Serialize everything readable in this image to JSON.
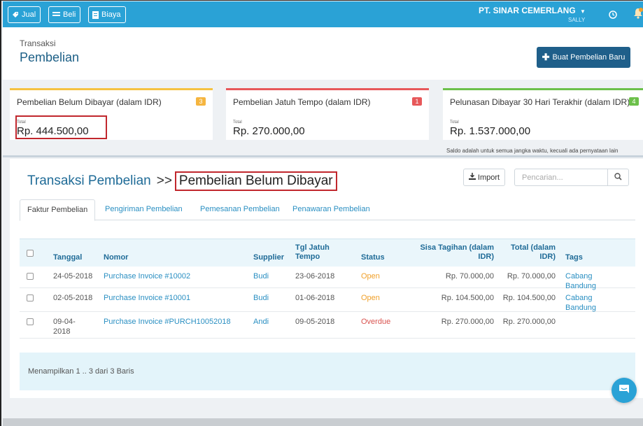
{
  "topbar": {
    "sell_label": "Jual",
    "buy_label": "Beli",
    "expense_label": "Biaya",
    "company": "PT. SINAR CEMERLANG",
    "user": "SALLY",
    "icons": [
      "tag-icon",
      "list-icon",
      "document-icon",
      "chevron-down-icon",
      "clock-icon",
      "bell-icon"
    ]
  },
  "header": {
    "breadcrumb": "Transaksi",
    "title": "Pembelian",
    "new_button": "Buat Pembelian Baru"
  },
  "cards": [
    {
      "title": "Pembelian Belum Dibayar (dalam IDR)",
      "badge": "3",
      "total_label": "Total",
      "amount": "Rp. 444.500,00",
      "color": "#f5c242"
    },
    {
      "title": "Pembelian Jatuh Tempo (dalam IDR)",
      "badge": "1",
      "total_label": "Total",
      "amount": "Rp. 270.000,00",
      "color": "#e7585a"
    },
    {
      "title": "Pelunasan Dibayar 30 Hari Terakhir (dalam IDR)",
      "badge": "4",
      "total_label": "Total",
      "amount": "Rp. 1.537.000,00",
      "color": "#6cc04a"
    }
  ],
  "balance_note": "Saldo adalah untuk semua jangka waktu, kecuali ada pernyataan lain",
  "panel": {
    "title": "Transaksi Pembelian",
    "separator": ">>",
    "subtitle": "Pembelian Belum Dibayar",
    "import_label": "Import",
    "search_placeholder": "Pencarian...",
    "tabs": [
      "Faktur Pembelian",
      "Pengiriman Pembelian",
      "Pemesanan Pembelian",
      "Penawaran Pembelian"
    ],
    "active_tab": "Faktur Pembelian"
  },
  "table": {
    "columns": {
      "date": "Tanggal",
      "number": "Nomor",
      "supplier": "Supplier",
      "due_line1": "Tgl Jatuh",
      "due_line2": "Tempo",
      "status": "Status",
      "balance_line1": "Sisa Tagihan (dalam",
      "balance_line2": "IDR)",
      "total_line1": "Total (dalam",
      "total_line2": "IDR)",
      "tags": "Tags"
    },
    "rows": [
      {
        "date": "24-05-2018",
        "number": "Purchase Invoice #10002",
        "supplier": "Budi",
        "due": "23-06-2018",
        "status": "Open",
        "balance": "Rp. 70.000,00",
        "total": "Rp. 70.000,00",
        "tag1": "Cabang",
        "tag2": "Bandung"
      },
      {
        "date": "02-05-2018",
        "number": "Purchase Invoice #10001",
        "supplier": "Budi",
        "due": "01-06-2018",
        "status": "Open",
        "balance": "Rp. 104.500,00",
        "total": "Rp. 104.500,00",
        "tag1": "Cabang",
        "tag2": "Bandung"
      },
      {
        "date1": "09-04-",
        "date2": "2018",
        "number": "Purchase Invoice #PURCH10052018",
        "supplier": "Andi",
        "due": "09-05-2018",
        "status": "Overdue",
        "balance": "Rp. 270.000,00",
        "total": "Rp. 270.000,00",
        "tag1": "",
        "tag2": ""
      }
    ],
    "footer": "Menampilkan 1 .. 3 dari 3 Baris"
  },
  "colors": {
    "accent": "#2aa2d6",
    "primary_dark": "#1f5f8a",
    "highlight_box": "#c1272d"
  }
}
